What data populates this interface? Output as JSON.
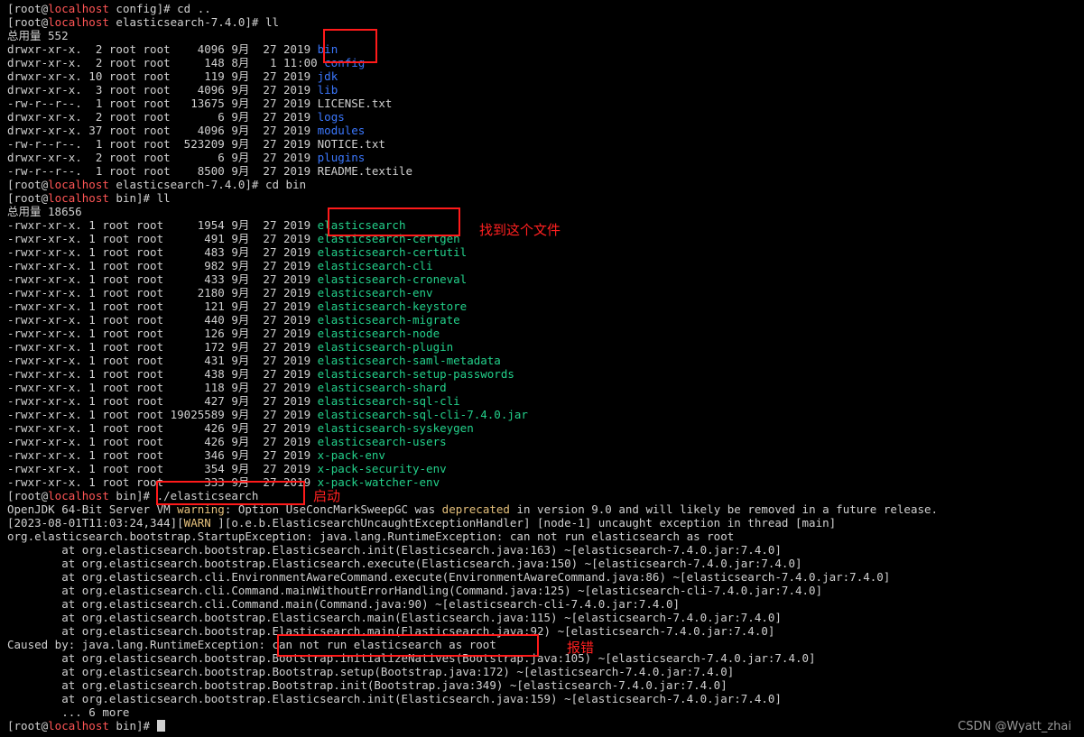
{
  "colors": {
    "background": "#000000",
    "text": "#d0d0d0",
    "host": "#ff5555",
    "directory": "#3b78ff",
    "executable": "#23d18b",
    "warning": "#e5c07b",
    "annotation": "#ff1a1a"
  },
  "lines": [
    [
      {
        "t": "[root@"
      },
      {
        "t": "localhost",
        "c": "host"
      },
      {
        "t": " config]# cd .."
      }
    ],
    [
      {
        "t": "[root@"
      },
      {
        "t": "localhost",
        "c": "host"
      },
      {
        "t": " elasticsearch-7.4.0]# ll"
      }
    ],
    [
      {
        "t": "总用量 552"
      }
    ],
    [
      {
        "t": "drwxr-xr-x.  2 root root    4096 9月  27 2019 "
      },
      {
        "t": "bin",
        "c": "dir"
      }
    ],
    [
      {
        "t": "drwxr-xr-x.  2 root root     148 8月   1 11:00 "
      },
      {
        "t": "config",
        "c": "dir"
      }
    ],
    [
      {
        "t": "drwxr-xr-x. 10 root root     119 9月  27 2019 "
      },
      {
        "t": "jdk",
        "c": "dir"
      }
    ],
    [
      {
        "t": "drwxr-xr-x.  3 root root    4096 9月  27 2019 "
      },
      {
        "t": "lib",
        "c": "dir"
      }
    ],
    [
      {
        "t": "-rw-r--r--.  1 root root   13675 9月  27 2019 LICENSE.txt"
      }
    ],
    [
      {
        "t": "drwxr-xr-x.  2 root root       6 9月  27 2019 "
      },
      {
        "t": "logs",
        "c": "dir"
      }
    ],
    [
      {
        "t": "drwxr-xr-x. 37 root root    4096 9月  27 2019 "
      },
      {
        "t": "modules",
        "c": "dir"
      }
    ],
    [
      {
        "t": "-rw-r--r--.  1 root root  523209 9月  27 2019 NOTICE.txt"
      }
    ],
    [
      {
        "t": "drwxr-xr-x.  2 root root       6 9月  27 2019 "
      },
      {
        "t": "plugins",
        "c": "dir"
      }
    ],
    [
      {
        "t": "-rw-r--r--.  1 root root    8500 9月  27 2019 README.textile"
      }
    ],
    [
      {
        "t": "[root@"
      },
      {
        "t": "localhost",
        "c": "host"
      },
      {
        "t": " elasticsearch-7.4.0]# cd bin"
      }
    ],
    [
      {
        "t": "[root@"
      },
      {
        "t": "localhost",
        "c": "host"
      },
      {
        "t": " bin]# ll"
      }
    ],
    [
      {
        "t": "总用量 18656"
      }
    ],
    [
      {
        "t": "-rwxr-xr-x. 1 root root     1954 9月  27 2019 "
      },
      {
        "t": "elasticsearch",
        "c": "exec"
      }
    ],
    [
      {
        "t": "-rwxr-xr-x. 1 root root      491 9月  27 2019 "
      },
      {
        "t": "elasticsearch-certgen",
        "c": "exec"
      }
    ],
    [
      {
        "t": "-rwxr-xr-x. 1 root root      483 9月  27 2019 "
      },
      {
        "t": "elasticsearch-certutil",
        "c": "exec"
      }
    ],
    [
      {
        "t": "-rwxr-xr-x. 1 root root      982 9月  27 2019 "
      },
      {
        "t": "elasticsearch-cli",
        "c": "exec"
      }
    ],
    [
      {
        "t": "-rwxr-xr-x. 1 root root      433 9月  27 2019 "
      },
      {
        "t": "elasticsearch-croneval",
        "c": "exec"
      }
    ],
    [
      {
        "t": "-rwxr-xr-x. 1 root root     2180 9月  27 2019 "
      },
      {
        "t": "elasticsearch-env",
        "c": "exec"
      }
    ],
    [
      {
        "t": "-rwxr-xr-x. 1 root root      121 9月  27 2019 "
      },
      {
        "t": "elasticsearch-keystore",
        "c": "exec"
      }
    ],
    [
      {
        "t": "-rwxr-xr-x. 1 root root      440 9月  27 2019 "
      },
      {
        "t": "elasticsearch-migrate",
        "c": "exec"
      }
    ],
    [
      {
        "t": "-rwxr-xr-x. 1 root root      126 9月  27 2019 "
      },
      {
        "t": "elasticsearch-node",
        "c": "exec"
      }
    ],
    [
      {
        "t": "-rwxr-xr-x. 1 root root      172 9月  27 2019 "
      },
      {
        "t": "elasticsearch-plugin",
        "c": "exec"
      }
    ],
    [
      {
        "t": "-rwxr-xr-x. 1 root root      431 9月  27 2019 "
      },
      {
        "t": "elasticsearch-saml-metadata",
        "c": "exec"
      }
    ],
    [
      {
        "t": "-rwxr-xr-x. 1 root root      438 9月  27 2019 "
      },
      {
        "t": "elasticsearch-setup-passwords",
        "c": "exec"
      }
    ],
    [
      {
        "t": "-rwxr-xr-x. 1 root root      118 9月  27 2019 "
      },
      {
        "t": "elasticsearch-shard",
        "c": "exec"
      }
    ],
    [
      {
        "t": "-rwxr-xr-x. 1 root root      427 9月  27 2019 "
      },
      {
        "t": "elasticsearch-sql-cli",
        "c": "exec"
      }
    ],
    [
      {
        "t": "-rwxr-xr-x. 1 root root 19025589 9月  27 2019 "
      },
      {
        "t": "elasticsearch-sql-cli-7.4.0.jar",
        "c": "exec"
      }
    ],
    [
      {
        "t": "-rwxr-xr-x. 1 root root      426 9月  27 2019 "
      },
      {
        "t": "elasticsearch-syskeygen",
        "c": "exec"
      }
    ],
    [
      {
        "t": "-rwxr-xr-x. 1 root root      426 9月  27 2019 "
      },
      {
        "t": "elasticsearch-users",
        "c": "exec"
      }
    ],
    [
      {
        "t": "-rwxr-xr-x. 1 root root      346 9月  27 2019 "
      },
      {
        "t": "x-pack-env",
        "c": "exec"
      }
    ],
    [
      {
        "t": "-rwxr-xr-x. 1 root root      354 9月  27 2019 "
      },
      {
        "t": "x-pack-security-env",
        "c": "exec"
      }
    ],
    [
      {
        "t": "-rwxr-xr-x. 1 root root      333 9月  27 2019 "
      },
      {
        "t": "x-pack-watcher-env",
        "c": "exec"
      }
    ],
    [
      {
        "t": "[root@"
      },
      {
        "t": "localhost",
        "c": "host"
      },
      {
        "t": " bin]# ./elasticsearch"
      }
    ],
    [
      {
        "t": "OpenJDK 64-Bit Server VM "
      },
      {
        "t": "warning",
        "c": "warn"
      },
      {
        "t": ": Option UseConcMarkSweepGC was "
      },
      {
        "t": "deprecated",
        "c": "warn"
      },
      {
        "t": " in version 9.0 and will likely be removed in a future release."
      }
    ],
    [
      {
        "t": "[2023-08-01T11:03:24,344]["
      },
      {
        "t": "WARN",
        "c": "warn"
      },
      {
        "t": " ][o.e.b.ElasticsearchUncaughtExceptionHandler] [node-1] uncaught exception in thread [main]"
      }
    ],
    [
      {
        "t": "org.elasticsearch.bootstrap.StartupException: java.lang.RuntimeException: can not run elasticsearch as root"
      }
    ],
    [
      {
        "t": "        at org.elasticsearch.bootstrap.Elasticsearch.init(Elasticsearch.java:163) ~[elasticsearch-7.4.0.jar:7.4.0]"
      }
    ],
    [
      {
        "t": "        at org.elasticsearch.bootstrap.Elasticsearch.execute(Elasticsearch.java:150) ~[elasticsearch-7.4.0.jar:7.4.0]"
      }
    ],
    [
      {
        "t": "        at org.elasticsearch.cli.EnvironmentAwareCommand.execute(EnvironmentAwareCommand.java:86) ~[elasticsearch-7.4.0.jar:7.4.0]"
      }
    ],
    [
      {
        "t": "        at org.elasticsearch.cli.Command.mainWithoutErrorHandling(Command.java:125) ~[elasticsearch-cli-7.4.0.jar:7.4.0]"
      }
    ],
    [
      {
        "t": "        at org.elasticsearch.cli.Command.main(Command.java:90) ~[elasticsearch-cli-7.4.0.jar:7.4.0]"
      }
    ],
    [
      {
        "t": "        at org.elasticsearch.bootstrap.Elasticsearch.main(Elasticsearch.java:115) ~[elasticsearch-7.4.0.jar:7.4.0]"
      }
    ],
    [
      {
        "t": "        at org.elasticsearch.bootstrap.Elasticsearch.main(Elasticsearch.java:92) ~[elasticsearch-7.4.0.jar:7.4.0]"
      }
    ],
    [
      {
        "t": "Caused by: java.lang.RuntimeException: can not run elasticsearch as root"
      }
    ],
    [
      {
        "t": "        at org.elasticsearch.bootstrap.Bootstrap.initializeNatives(Bootstrap.java:105) ~[elasticsearch-7.4.0.jar:7.4.0]"
      }
    ],
    [
      {
        "t": "        at org.elasticsearch.bootstrap.Bootstrap.setup(Bootstrap.java:172) ~[elasticsearch-7.4.0.jar:7.4.0]"
      }
    ],
    [
      {
        "t": "        at org.elasticsearch.bootstrap.Bootstrap.init(Bootstrap.java:349) ~[elasticsearch-7.4.0.jar:7.4.0]"
      }
    ],
    [
      {
        "t": "        at org.elasticsearch.bootstrap.Elasticsearch.init(Elasticsearch.java:159) ~[elasticsearch-7.4.0.jar:7.4.0]"
      }
    ],
    [
      {
        "t": "        ... 6 more"
      }
    ],
    [
      {
        "t": "[root@"
      },
      {
        "t": "localhost",
        "c": "host"
      },
      {
        "t": " bin]# "
      }
    ]
  ],
  "annotations": {
    "find_file": "找到这个文件",
    "start": "启动",
    "error": "报错"
  },
  "watermark": "CSDN @Wyatt_zhai"
}
